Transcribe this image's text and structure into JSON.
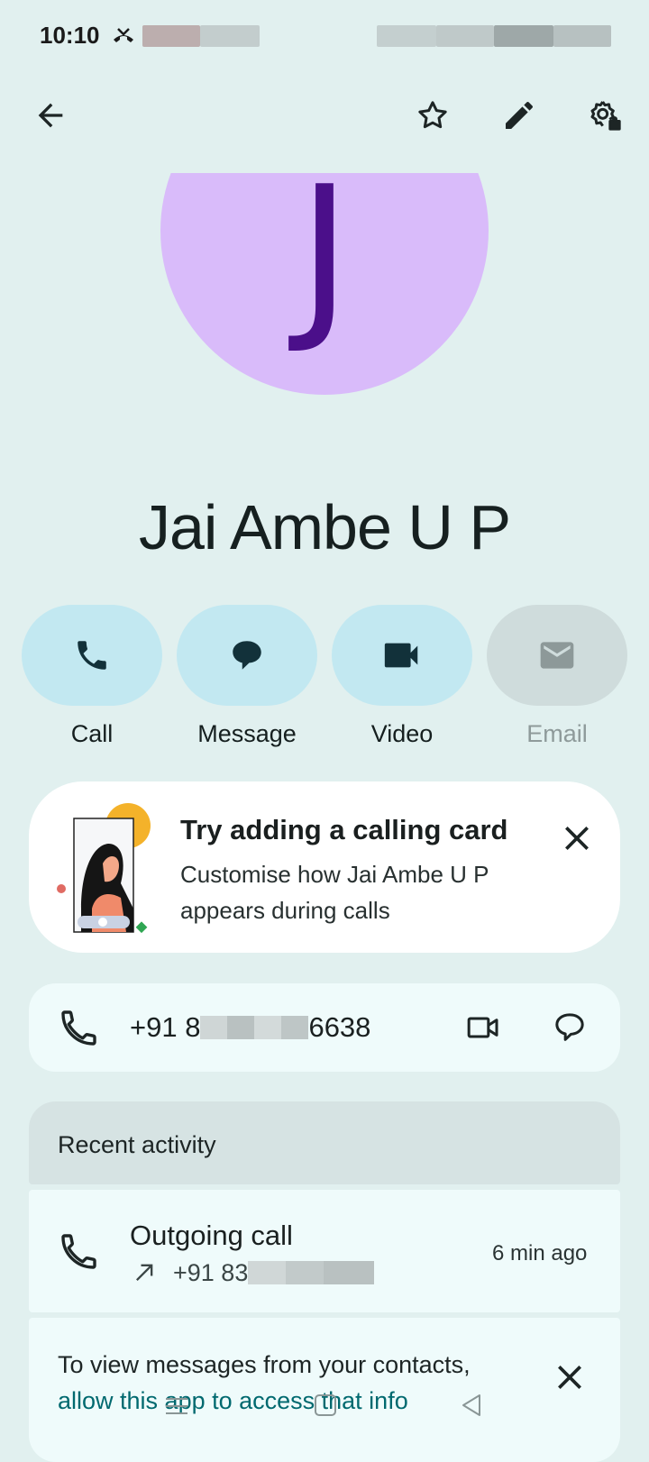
{
  "status_bar": {
    "time": "10:10"
  },
  "contact": {
    "initial": "J",
    "name": "Jai Ambe U P"
  },
  "actions": [
    {
      "label": "Call",
      "icon": "phone-icon",
      "enabled": true
    },
    {
      "label": "Message",
      "icon": "message-icon",
      "enabled": true
    },
    {
      "label": "Video",
      "icon": "video-icon",
      "enabled": true
    },
    {
      "label": "Email",
      "icon": "email-icon",
      "enabled": false
    }
  ],
  "calling_card": {
    "title": "Try adding a calling card",
    "body": "Customise how Jai Ambe U P appears during calls"
  },
  "phone": {
    "number_prefix": "+91 8",
    "number_suffix": "6638"
  },
  "recent_activity": {
    "title": "Recent activity",
    "items": [
      {
        "type": "Outgoing call",
        "number_prefix": "+91 83",
        "time": "6 min ago"
      }
    ]
  },
  "permission_banner": {
    "text": "To view messages from your contacts,",
    "link": "allow this app to access that info"
  },
  "colors": {
    "background": "#e1f0ef",
    "avatar": "#d9bbfa",
    "avatar_text": "#4b0f8a",
    "action_pill": "#c2e8f1",
    "link": "#00696f"
  }
}
